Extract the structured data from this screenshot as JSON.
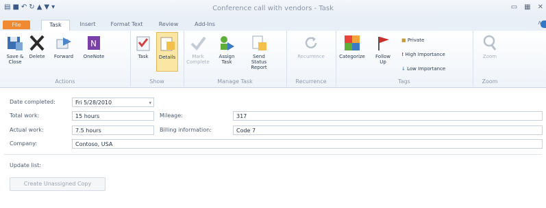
{
  "window": {
    "title": "Conference call with vendors - Task",
    "qat_icons": [
      "app-icon",
      "save-icon",
      "undo-icon",
      "redo-icon",
      "up-icon",
      "down-icon",
      "customize-icon"
    ],
    "controls": [
      "minimize-icon",
      "maximize-icon",
      "close-icon"
    ]
  },
  "tabs": [
    "File",
    "Task",
    "Insert",
    "Format Text",
    "Review",
    "Add-Ins"
  ],
  "ribbon": {
    "groups": {
      "actions": "Actions",
      "show": "Show",
      "manage": "Manage Task",
      "recurrence": "Recurrence",
      "tags": "Tags",
      "zoom": "Zoom"
    },
    "buttons": {
      "save_close": "Save & Close",
      "delete": "Delete",
      "forward": "Forward",
      "onenote": "OneNote",
      "task": "Task",
      "details": "Details",
      "mark_complete": "Mark Complete",
      "assign_task": "Assign Task",
      "send_status": "Send Status Report",
      "recurrence": "Recurrence",
      "categorize": "Categorize",
      "follow_up": "Follow Up",
      "private": "Private",
      "high_importance": "High Importance",
      "low_importance": "Low Importance",
      "zoom": "Zoom"
    }
  },
  "form": {
    "date_completed_label": "Date completed:",
    "date_completed_value": "Fri 5/28/2010",
    "total_work_label": "Total work:",
    "total_work_value": "15 hours",
    "actual_work_label": "Actual work:",
    "actual_work_value": "7.5 hours",
    "company_label": "Company:",
    "company_value": "Contoso, USA",
    "mileage_label": "Mileage:",
    "mileage_value": "317",
    "billing_label": "Billing information:",
    "billing_value": "Code 7",
    "update_list_label": "Update list:",
    "create_copy_label": "Create Unassigned Copy"
  },
  "colors": {
    "file_tab": "#f08a32",
    "details_highlight": "#fbe7a3",
    "flag_red": "#c9302c",
    "category_green": "#5fae3a"
  }
}
